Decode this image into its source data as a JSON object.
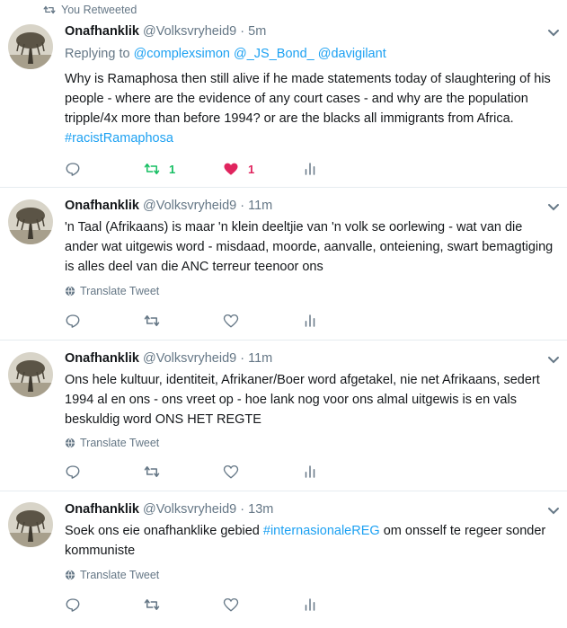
{
  "retweet_banner": "You Retweeted",
  "tweets": [
    {
      "name": "Onafhanklik",
      "handle": "@Volksvryheid9",
      "sep": "·",
      "time": "5m",
      "reply_prefix": "Replying to",
      "reply_mentions": [
        "@complexsimon",
        "@_JS_Bond_",
        "@davigilant"
      ],
      "text": "Why is Ramaphosa then still alive if he made statements today of slaughtering of his people - where are the evidence of any court cases - and why are the population tripple/4x more than before 1994? or are the blacks all immigrants from Africa.",
      "hashtag": "#racistRamaphosa",
      "retweet_count": "1",
      "like_count": "1"
    },
    {
      "name": "Onafhanklik",
      "handle": "@Volksvryheid9",
      "sep": "·",
      "time": "11m",
      "text": "'n Taal (Afrikaans) is maar 'n klein deeltjie van 'n volk se oorlewing - wat van die ander wat uitgewis word - misdaad, moorde, aanvalle, onteiening, swart bemagtiging is alles deel van die ANC terreur teenoor ons",
      "translate": "Translate Tweet"
    },
    {
      "name": "Onafhanklik",
      "handle": "@Volksvryheid9",
      "sep": "·",
      "time": "11m",
      "text": "Ons hele kultuur, identiteit, Afrikaner/Boer word afgetakel, nie net Afrikaans, sedert 1994 al en ons - ons vreet op - hoe lank nog voor ons almal uitgewis is en vals beskuldig word ONS HET REGTE",
      "translate": "Translate Tweet"
    },
    {
      "name": "Onafhanklik",
      "handle": "@Volksvryheid9",
      "sep": "·",
      "time": "13m",
      "text_before": "Soek ons eie onafhanklike gebied",
      "hashtag": "#internasionaleREG",
      "text_after": "om onsself te regeer sonder kommuniste",
      "translate": "Translate Tweet"
    }
  ],
  "colors": {
    "link": "#1da1f2",
    "retweet_green": "#17bf63",
    "like_red": "#e0245e",
    "muted": "#657786"
  }
}
